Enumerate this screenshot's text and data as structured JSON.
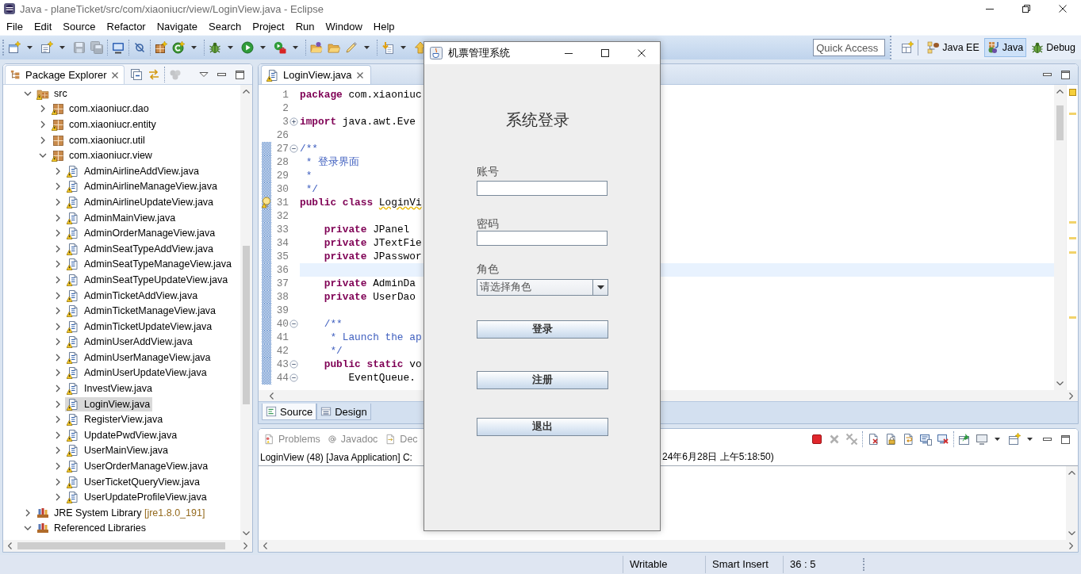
{
  "window": {
    "title": "Java - planeTicket/src/com/xiaoniucr/view/LoginView.java - Eclipse"
  },
  "menu": [
    "File",
    "Edit",
    "Source",
    "Refactor",
    "Navigate",
    "Search",
    "Project",
    "Run",
    "Window",
    "Help"
  ],
  "toolbar": {
    "groups": [
      [
        {
          "kind": "new",
          "dropdown": true,
          "disabled": false
        },
        {
          "kind": "new-type",
          "dropdown": true,
          "disabled": false
        },
        {
          "kind": "save",
          "dropdown": false,
          "disabled": true
        },
        {
          "kind": "save-all",
          "dropdown": false,
          "disabled": true
        }
      ],
      [
        {
          "kind": "terminal",
          "dropdown": false,
          "disabled": false
        }
      ],
      [
        {
          "kind": "skip",
          "dropdown": false,
          "disabled": false
        }
      ],
      [
        {
          "kind": "package",
          "dropdown": false,
          "disabled": false
        },
        {
          "kind": "class",
          "dropdown": true,
          "disabled": false
        }
      ],
      [
        {
          "kind": "debug",
          "dropdown": true,
          "disabled": false
        },
        {
          "kind": "run",
          "dropdown": true,
          "disabled": false
        },
        {
          "kind": "external",
          "dropdown": true,
          "disabled": false
        }
      ],
      [
        {
          "kind": "open-type",
          "dropdown": false,
          "disabled": false
        },
        {
          "kind": "open-task",
          "dropdown": false,
          "disabled": false
        },
        {
          "kind": "marker",
          "dropdown": true,
          "disabled": false
        }
      ],
      [
        {
          "kind": "next",
          "dropdown": true,
          "disabled": false
        },
        {
          "kind": "previous",
          "dropdown": false,
          "disabled": false
        }
      ]
    ],
    "quick_access": {
      "placeholder": "Quick Access"
    },
    "perspectives": [
      {
        "kind": "ee",
        "label": "Java EE",
        "selected": false
      },
      {
        "kind": "java",
        "label": "Java",
        "selected": true
      },
      {
        "kind": "debug",
        "label": "Debug",
        "selected": false
      }
    ]
  },
  "package_explorer": {
    "title": "Package Explorer",
    "tools": [
      [
        {
          "kind": "collapse",
          "dropdown": false,
          "disabled": false
        },
        {
          "kind": "link",
          "dropdown": false,
          "disabled": false
        }
      ],
      [
        {
          "kind": "focus",
          "dropdown": false,
          "disabled": true
        }
      ]
    ],
    "tree": [
      {
        "label": "src",
        "kind": "folder",
        "warning": true,
        "expanded": true,
        "selected": false,
        "children": [
          {
            "label": "com.xiaoniucr.dao",
            "kind": "package",
            "warning": true,
            "expanded": false,
            "selected": false
          },
          {
            "label": "com.xiaoniucr.entity",
            "kind": "package",
            "warning": true,
            "expanded": false,
            "selected": false
          },
          {
            "label": "com.xiaoniucr.util",
            "kind": "package",
            "warning": false,
            "expanded": false,
            "selected": false
          },
          {
            "label": "com.xiaoniucr.view",
            "kind": "package",
            "warning": true,
            "expanded": true,
            "selected": false,
            "children": [
              {
                "label": "AdminAirlineAddView.java",
                "kind": "file",
                "warning": true,
                "expanded": false,
                "selected": false
              },
              {
                "label": "AdminAirlineManageView.java",
                "kind": "file",
                "warning": true,
                "expanded": false,
                "selected": false
              },
              {
                "label": "AdminAirlineUpdateView.java",
                "kind": "file",
                "warning": true,
                "expanded": false,
                "selected": false
              },
              {
                "label": "AdminMainView.java",
                "kind": "file",
                "warning": true,
                "expanded": false,
                "selected": false
              },
              {
                "label": "AdminOrderManageView.java",
                "kind": "file",
                "warning": true,
                "expanded": false,
                "selected": false
              },
              {
                "label": "AdminSeatTypeAddView.java",
                "kind": "file",
                "warning": true,
                "expanded": false,
                "selected": false
              },
              {
                "label": "AdminSeatTypeManageView.java",
                "kind": "file",
                "warning": true,
                "expanded": false,
                "selected": false
              },
              {
                "label": "AdminSeatTypeUpdateView.java",
                "kind": "file",
                "warning": true,
                "expanded": false,
                "selected": false
              },
              {
                "label": "AdminTicketAddView.java",
                "kind": "file",
                "warning": true,
                "expanded": false,
                "selected": false
              },
              {
                "label": "AdminTicketManageView.java",
                "kind": "file",
                "warning": true,
                "expanded": false,
                "selected": false
              },
              {
                "label": "AdminTicketUpdateView.java",
                "kind": "file",
                "warning": true,
                "expanded": false,
                "selected": false
              },
              {
                "label": "AdminUserAddView.java",
                "kind": "file",
                "warning": true,
                "expanded": false,
                "selected": false
              },
              {
                "label": "AdminUserManageView.java",
                "kind": "file",
                "warning": true,
                "expanded": false,
                "selected": false
              },
              {
                "label": "AdminUserUpdateView.java",
                "kind": "file",
                "warning": true,
                "expanded": false,
                "selected": false
              },
              {
                "label": "InvestView.java",
                "kind": "file",
                "warning": true,
                "expanded": false,
                "selected": false
              },
              {
                "label": "LoginView.java",
                "kind": "file",
                "warning": true,
                "expanded": false,
                "selected": true
              },
              {
                "label": "RegisterView.java",
                "kind": "file",
                "warning": true,
                "expanded": false,
                "selected": false
              },
              {
                "label": "UpdatePwdView.java",
                "kind": "file",
                "warning": true,
                "expanded": false,
                "selected": false
              },
              {
                "label": "UserMainView.java",
                "kind": "file",
                "warning": true,
                "expanded": false,
                "selected": false
              },
              {
                "label": "UserOrderManageView.java",
                "kind": "file",
                "warning": true,
                "expanded": false,
                "selected": false
              },
              {
                "label": "UserTicketQueryView.java",
                "kind": "file",
                "warning": true,
                "expanded": false,
                "selected": false
              },
              {
                "label": "UserUpdateProfileView.java",
                "kind": "file",
                "warning": true,
                "expanded": false,
                "selected": false
              }
            ]
          }
        ]
      },
      {
        "label": "JRE System Library",
        "decoration": "[jre1.8.0_191]",
        "kind": "library",
        "warning": false,
        "expanded": false,
        "selected": false
      },
      {
        "label": "Referenced Libraries",
        "kind": "library",
        "warning": false,
        "expanded": true,
        "selected": false
      }
    ]
  },
  "editor": {
    "tab": {
      "label": "LoginView.java",
      "warning": true
    },
    "lines": [
      {
        "number": "1",
        "tokens": [
          {
            "kind": "keyword",
            "text": "package"
          },
          {
            "kind": "plain",
            "text": " com.xiaoniuc"
          }
        ],
        "changed": false,
        "current": false,
        "warning": false
      },
      {
        "number": "2",
        "changed": false,
        "current": false,
        "warning": false
      },
      {
        "number": "3",
        "fold": {
          "expanded": false
        },
        "tokens": [
          {
            "kind": "keyword",
            "text": "import"
          },
          {
            "kind": "plain",
            "text": " java.awt.Eve"
          }
        ],
        "changed": false,
        "current": false,
        "warning": false
      },
      {
        "number": "26",
        "changed": false,
        "current": false,
        "warning": false
      },
      {
        "number": "27",
        "fold": {
          "expanded": true
        },
        "tokens": [
          {
            "kind": "comment",
            "text": "/**"
          }
        ],
        "changed": true,
        "current": false,
        "warning": false
      },
      {
        "number": "28",
        "tokens": [
          {
            "kind": "comment",
            "text": " * 登录界面"
          }
        ],
        "changed": true,
        "current": false,
        "warning": false
      },
      {
        "number": "29",
        "tokens": [
          {
            "kind": "comment",
            "text": " *"
          }
        ],
        "changed": true,
        "current": false,
        "warning": false
      },
      {
        "number": "30",
        "tokens": [
          {
            "kind": "comment",
            "text": " */"
          }
        ],
        "changed": true,
        "current": false,
        "warning": false
      },
      {
        "number": "31",
        "tokens": [
          {
            "kind": "keyword",
            "text": "public class "
          },
          {
            "kind": "flagged",
            "text": "LoginVi"
          }
        ],
        "changed": true,
        "current": false,
        "warning": true
      },
      {
        "number": "32",
        "changed": true,
        "current": false,
        "warning": false
      },
      {
        "number": "33",
        "tokens": [
          {
            "kind": "keyword",
            "text": "    private"
          },
          {
            "kind": "plain",
            "text": " JPanel"
          }
        ],
        "changed": true,
        "current": false,
        "warning": false
      },
      {
        "number": "34",
        "tokens": [
          {
            "kind": "keyword",
            "text": "    private"
          },
          {
            "kind": "plain",
            "text": " JTextFie"
          }
        ],
        "changed": true,
        "current": false,
        "warning": false
      },
      {
        "number": "35",
        "tokens": [
          {
            "kind": "keyword",
            "text": "    private"
          },
          {
            "kind": "plain",
            "text": " JPasswor"
          }
        ],
        "changed": true,
        "current": false,
        "warning": false
      },
      {
        "number": "36",
        "changed": true,
        "current": true,
        "warning": false
      },
      {
        "number": "37",
        "tokens": [
          {
            "kind": "keyword",
            "text": "    private"
          },
          {
            "kind": "plain",
            "text": " AdminDa"
          }
        ],
        "changed": true,
        "current": false,
        "warning": false
      },
      {
        "number": "38",
        "tokens": [
          {
            "kind": "keyword",
            "text": "    private"
          },
          {
            "kind": "plain",
            "text": " UserDao"
          }
        ],
        "changed": true,
        "current": false,
        "warning": false
      },
      {
        "number": "39",
        "changed": true,
        "current": false,
        "warning": false
      },
      {
        "number": "40",
        "fold": {
          "expanded": true
        },
        "tokens": [
          {
            "kind": "comment",
            "text": "    /**"
          }
        ],
        "changed": true,
        "current": false,
        "warning": false
      },
      {
        "number": "41",
        "tokens": [
          {
            "kind": "comment",
            "text": "     * Launch the ap"
          }
        ],
        "changed": true,
        "current": false,
        "warning": false
      },
      {
        "number": "42",
        "tokens": [
          {
            "kind": "comment",
            "text": "     */"
          }
        ],
        "changed": true,
        "current": false,
        "warning": false
      },
      {
        "number": "43",
        "fold": {
          "expanded": true
        },
        "tokens": [
          {
            "kind": "keyword",
            "text": "    public static"
          },
          {
            "kind": "plain",
            "text": " vo"
          }
        ],
        "changed": true,
        "current": false,
        "warning": false
      },
      {
        "number": "44",
        "fold": {
          "expanded": true
        },
        "tokens": [
          {
            "kind": "plain",
            "text": "        EventQueue."
          }
        ],
        "changed": true,
        "current": false,
        "warning": false
      }
    ],
    "modes": [
      {
        "kind": "source",
        "label": "Source",
        "selected": true
      },
      {
        "kind": "design",
        "label": "Design",
        "selected": false
      }
    ]
  },
  "console": {
    "tabs": [
      {
        "kind": "problems",
        "label": "Problems",
        "selected": false
      },
      {
        "kind": "javadoc",
        "label": "Javadoc",
        "selected": false
      },
      {
        "kind": "declaration",
        "label": "Dec",
        "selected": false
      }
    ],
    "tools": [
      [
        {
          "kind": "terminate",
          "dropdown": false,
          "disabled": false
        },
        {
          "kind": "remove",
          "dropdown": false,
          "disabled": true
        },
        {
          "kind": "remove-all",
          "dropdown": false,
          "disabled": true
        }
      ],
      [
        {
          "kind": "clear",
          "dropdown": false,
          "disabled": false
        },
        {
          "kind": "scroll-lock",
          "dropdown": false,
          "disabled": false
        },
        {
          "kind": "word-wrap",
          "dropdown": false,
          "disabled": false
        },
        {
          "kind": "show-out",
          "dropdown": false,
          "disabled": false
        },
        {
          "kind": "show-err",
          "dropdown": false,
          "disabled": false
        }
      ],
      [
        {
          "kind": "pin",
          "dropdown": false,
          "disabled": false
        },
        {
          "kind": "display",
          "dropdown": true,
          "disabled": false
        },
        {
          "kind": "open-console",
          "dropdown": true,
          "disabled": false
        }
      ]
    ],
    "title_left": "LoginView (48) [Java Application] C:",
    "title_right": "24年6月28日 上午5:18:50)"
  },
  "status_bar": [
    "Writable",
    "Smart Insert",
    "36 : 5"
  ],
  "dialog": {
    "title": "机票管理系统",
    "heading": "系统登录",
    "fields": [
      {
        "kind": "text",
        "label": "账号"
      },
      {
        "kind": "password",
        "label": "密码"
      },
      {
        "kind": "select",
        "label": "角色",
        "value": "请选择角色"
      }
    ],
    "buttons": [
      "登录",
      "注册",
      "退出"
    ]
  }
}
